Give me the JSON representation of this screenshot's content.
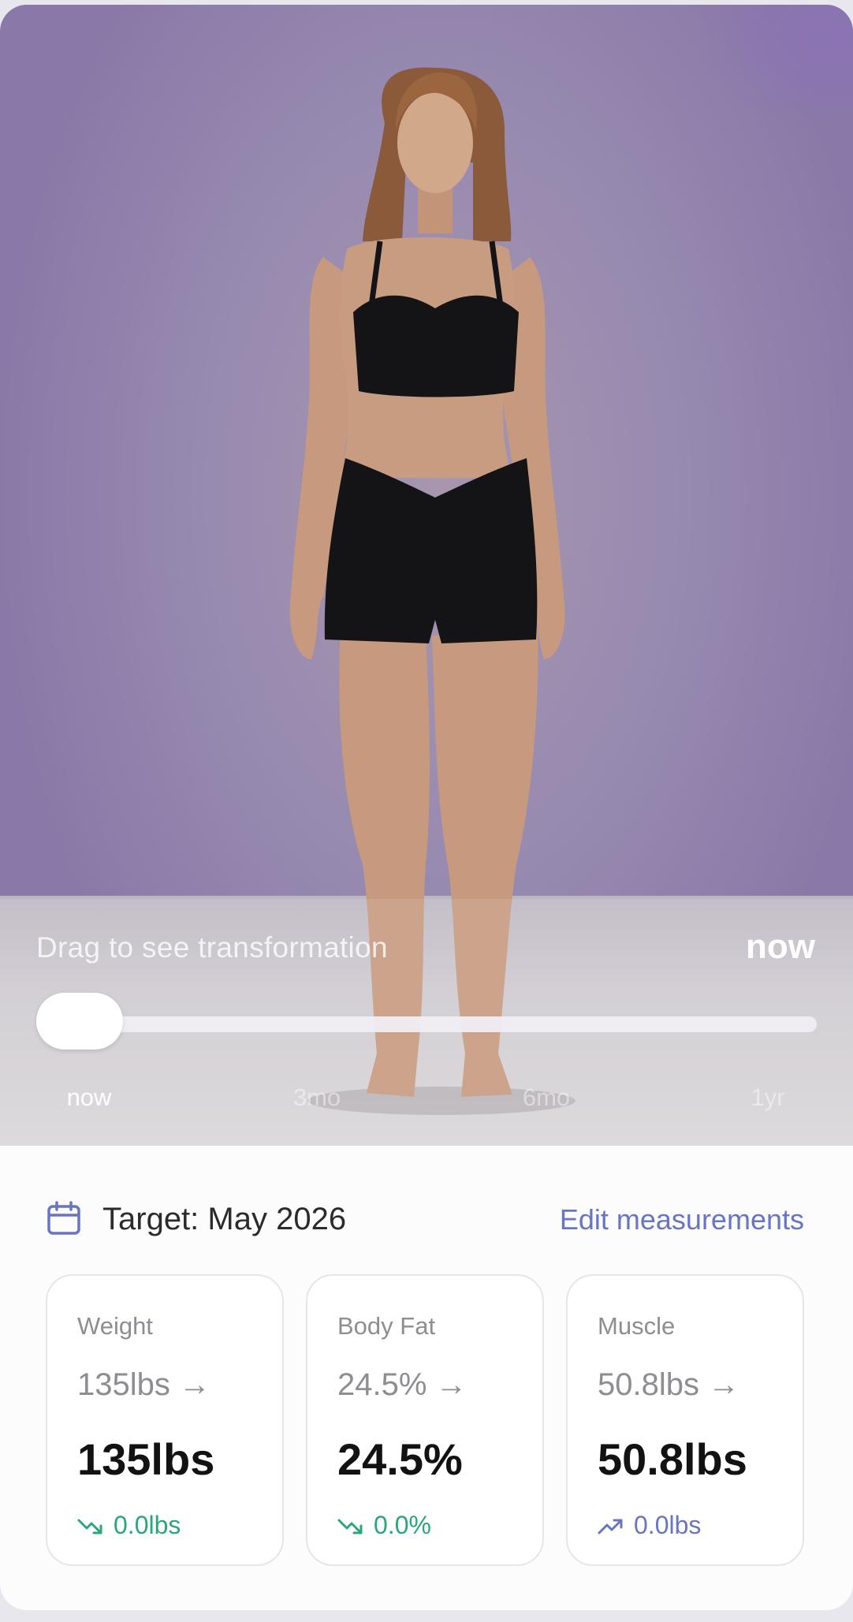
{
  "transformation": {
    "hint": "Drag to see transformation",
    "current_label": "now",
    "slider_progress": 0,
    "ticks": [
      "now",
      "3mo",
      "6mo",
      "1yr"
    ],
    "active_tick": 0
  },
  "target": {
    "label": "Target: May 2026",
    "edit_label": "Edit measurements",
    "icon": "calendar-icon"
  },
  "stats": [
    {
      "label": "Weight",
      "from": "135lbs →",
      "to": "135lbs",
      "delta": "0.0lbs",
      "trend": "down",
      "trend_color": "#2aa776"
    },
    {
      "label": "Body Fat",
      "from": "24.5% →",
      "to": "24.5%",
      "delta": "0.0%",
      "trend": "down",
      "trend_color": "#2aa776"
    },
    {
      "label": "Muscle",
      "from": "50.8lbs →",
      "to": "50.8lbs",
      "delta": "0.0lbs",
      "trend": "up",
      "trend_color": "#6874c4"
    }
  ],
  "colors": {
    "accent": "#6874c4",
    "positive": "#2aa776",
    "hero_bg": "#978ab0"
  }
}
